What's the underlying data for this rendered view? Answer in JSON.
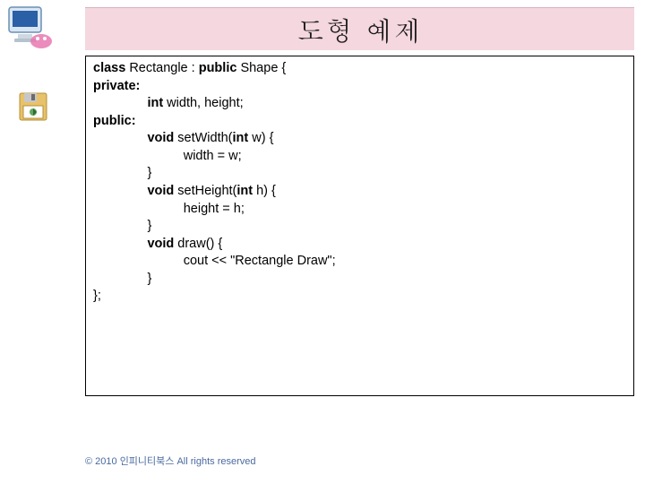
{
  "title": "도형 예제",
  "icons": {
    "monitor": "computer-monitor-icon",
    "floppy": "floppy-disk-icon"
  },
  "code": {
    "l1a": "class",
    "l1b": " Rectangle : ",
    "l1c": "public",
    "l1d": " Shape {",
    "l2": "private:",
    "l3a": "int",
    "l3b": " width, height;",
    "l4": "public:",
    "l5a": "void",
    "l5b": " setWidth(",
    "l5c": "int",
    "l5d": " w) {",
    "l6": "width = w;",
    "l7": "}",
    "l8a": "void",
    "l8b": " setHeight(",
    "l8c": "int",
    "l8d": " h) {",
    "l9": "height = h;",
    "l10": "}",
    "l11a": "void",
    "l11b": " draw() {",
    "l12a": "cout << ",
    "l12b": "\"Rectangle Draw\"",
    "l12c": ";",
    "l13": "}",
    "l14": "};"
  },
  "footer": "© 2010 인피니티북스 All rights reserved"
}
